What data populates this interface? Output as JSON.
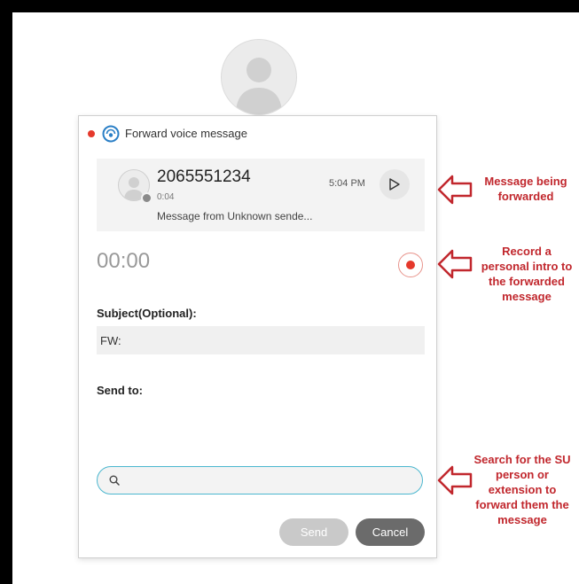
{
  "dialog": {
    "title": "Forward voice message",
    "message": {
      "number": "2065551234",
      "duration": "0:04",
      "preview": "Message from Unknown sende...",
      "time": "5:04 PM"
    },
    "timer": "00:00",
    "subject": {
      "label": "Subject(Optional):",
      "value": "FW:"
    },
    "send_to": {
      "label": "Send to:"
    },
    "search": {
      "value": ""
    },
    "buttons": {
      "send": "Send",
      "cancel": "Cancel"
    }
  },
  "annotations": {
    "message": "Message being forwarded",
    "record": "Record a personal intro to the forwarded message",
    "search": "Search for the SU person or extension to forward them the message"
  },
  "colors": {
    "annotation": "#c1272d",
    "record_dot": "#e5392c",
    "search_border": "#4bb7cf",
    "cancel_button": "#6b6b6b",
    "send_button_disabled": "#c9c9c9"
  }
}
